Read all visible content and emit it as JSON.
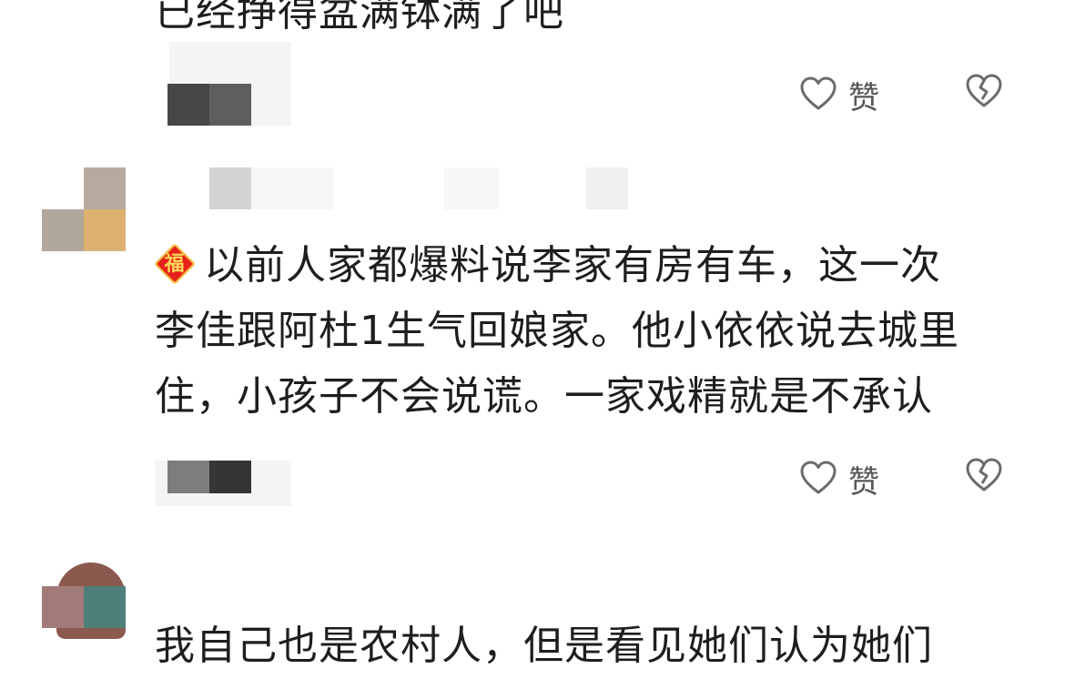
{
  "comments": [
    {
      "text_lines": [
        "已经挣得盆满钵满了吧"
      ],
      "like_label": "赞"
    },
    {
      "badge": "福",
      "text_lines": [
        "以前人家都爆料说李家有房有车，这一次",
        "李佳跟阿杜1生气回娘家。他小依依说去城里",
        "住，小孩子不会说谎。一家戏精就是不承认"
      ],
      "like_label": "赞"
    },
    {
      "text_lines": [
        "我自己也是农村人，但是看见她们认为她们"
      ]
    }
  ],
  "icons": {
    "like": "heart-outline-icon",
    "dislike": "broken-heart-icon",
    "badge": "fu-diamond-icon"
  },
  "colors": {
    "icon_stroke": "#6b6b6b",
    "badge_red": "#e8201c",
    "badge_gold": "#ffd95a"
  }
}
